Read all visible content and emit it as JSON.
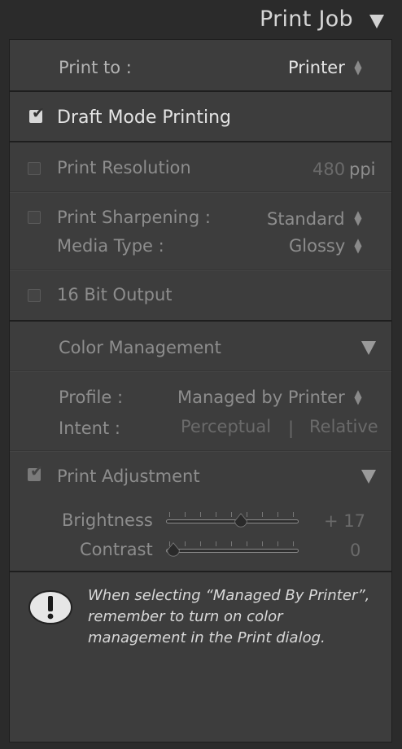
{
  "header": {
    "title": "Print Job",
    "collapse_icon": "triangle-down-icon"
  },
  "print_to": {
    "label": "Print to :",
    "value": "Printer"
  },
  "draft_mode": {
    "label": "Draft Mode Printing",
    "checked": true
  },
  "resolution": {
    "label": "Print Resolution",
    "value": "480",
    "unit": "ppi",
    "checked": false
  },
  "sharpening": {
    "label": "Print Sharpening :",
    "value": "Standard",
    "checked": false
  },
  "media_type": {
    "label": "Media Type :",
    "value": "Glossy"
  },
  "bit_output": {
    "label": "16 Bit Output",
    "checked": false
  },
  "color_management": {
    "title": "Color Management",
    "profile_label": "Profile :",
    "profile_value": "Managed by Printer",
    "intent_label": "Intent :",
    "intent_options": [
      "Perceptual",
      "Relative"
    ],
    "separator": "|"
  },
  "print_adjustment": {
    "label": "Print Adjustment",
    "checked": true,
    "brightness": {
      "label": "Brightness",
      "value": "+ 17",
      "level": 0.59
    },
    "contrast": {
      "label": "Contrast",
      "value": "0",
      "level": 0.0
    }
  },
  "warning": {
    "icon": "exclamation-icon",
    "lines": [
      "When selecting “Managed By Printer”,",
      "remember to turn on color",
      "management in the Print dialog."
    ]
  }
}
